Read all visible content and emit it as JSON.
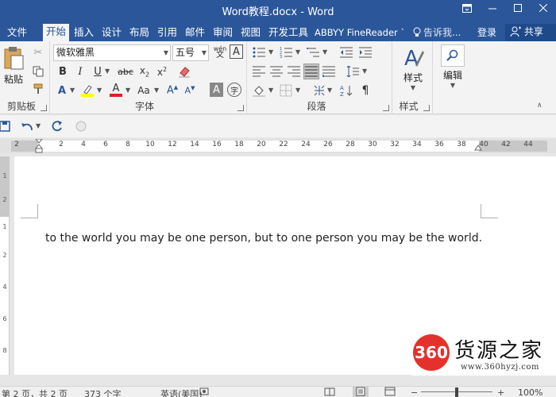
{
  "window": {
    "title": "Word教程.docx - Word",
    "controls": [
      "restore-ribbon",
      "minimize",
      "maximize",
      "close"
    ]
  },
  "tabs": [
    {
      "label": "文件"
    },
    {
      "label": "开始",
      "active": true
    },
    {
      "label": "插入"
    },
    {
      "label": "设计"
    },
    {
      "label": "布局"
    },
    {
      "label": "引用"
    },
    {
      "label": "邮件"
    },
    {
      "label": "审阅"
    },
    {
      "label": "视图"
    },
    {
      "label": "开发工具"
    },
    {
      "label": "ABBYY FineReader `"
    }
  ],
  "tell_me": "告诉我...",
  "login": "登录",
  "share": "共享",
  "ribbon": {
    "clipboard": {
      "label": "剪贴板",
      "paste": "粘贴"
    },
    "font": {
      "label": "字体",
      "font_name": "微软雅黑",
      "font_size": "五号",
      "phonetic": "wén",
      "highlight_color": "#ffff00",
      "font_color": "#e02020"
    },
    "paragraph": {
      "label": "段落"
    },
    "styles": {
      "label": "样式",
      "button": "样式"
    },
    "editing": {
      "button": "编辑"
    }
  },
  "ruler": {
    "ticks": [
      "2",
      "2",
      "4",
      "6",
      "8",
      "10",
      "12",
      "14",
      "16",
      "18",
      "20",
      "22",
      "24",
      "26",
      "28",
      "30",
      "32",
      "34",
      "36",
      "38",
      "40",
      "42",
      "44"
    ]
  },
  "vruler": {
    "ticks": [
      "1",
      "2",
      "1",
      "2",
      "4",
      "6",
      "8"
    ]
  },
  "document": {
    "text": "to the world you may be one person, but to one person you may be the world."
  },
  "watermark": {
    "logo": "360",
    "name": "货源之家",
    "url": "www.360hyzj.com"
  },
  "status": {
    "page": "第 2 页，共 2 页",
    "words": "373 个字",
    "language": "英语(美国)",
    "zoom": "100%"
  },
  "colors": {
    "accent": "#2b579a"
  }
}
